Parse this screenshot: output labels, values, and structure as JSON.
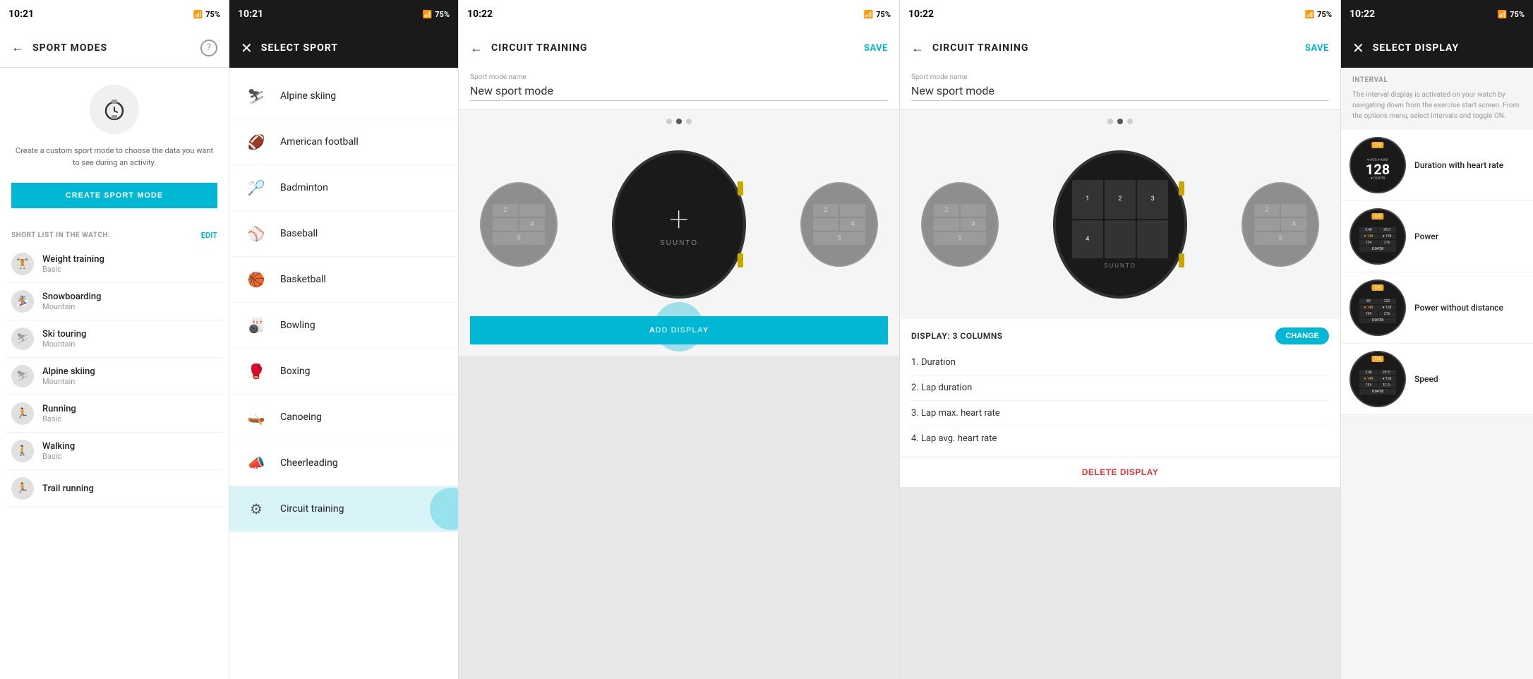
{
  "panel1": {
    "status_bar": {
      "time": "10:21",
      "battery": "75%"
    },
    "title": "SPORT MODES",
    "description": "Create a custom sport mode to choose the data you want to see during an activity.",
    "create_btn": "CREATE SPORT MODE",
    "short_list_title": "SHORT LIST IN THE WATCH:",
    "edit_label": "EDIT",
    "help": "?",
    "sport_items": [
      {
        "name": "Weight training",
        "sub": "Basic",
        "icon": "🏋"
      },
      {
        "name": "Snowboarding",
        "sub": "Mountain",
        "icon": "🏂"
      },
      {
        "name": "Ski touring",
        "sub": "Mountain",
        "icon": "⛷"
      },
      {
        "name": "Alpine skiing",
        "sub": "Mountain",
        "icon": "⛷"
      },
      {
        "name": "Running",
        "sub": "Basic",
        "icon": "🏃"
      },
      {
        "name": "Walking",
        "sub": "Basic",
        "icon": "🚶"
      },
      {
        "name": "Trail running",
        "sub": "",
        "icon": "🏃"
      }
    ]
  },
  "panel2": {
    "status_bar": {
      "time": "10:21",
      "battery": "75%"
    },
    "title": "SELECT SPORT",
    "sports": [
      {
        "name": "Alpine skiing",
        "icon": "⛷"
      },
      {
        "name": "American football",
        "icon": "🏈"
      },
      {
        "name": "Badminton",
        "icon": "🏸"
      },
      {
        "name": "Baseball",
        "icon": "⚾"
      },
      {
        "name": "Basketball",
        "icon": "🏀"
      },
      {
        "name": "Bowling",
        "icon": "🎳"
      },
      {
        "name": "Boxing",
        "icon": "🥊"
      },
      {
        "name": "Canoeing",
        "icon": "🛶"
      },
      {
        "name": "Cheerleading",
        "icon": "📣"
      },
      {
        "name": "Circuit training",
        "icon": "⚙"
      }
    ]
  },
  "panel3": {
    "status_bar": {
      "time": "10:22",
      "battery": "75%"
    },
    "title": "CIRCUIT TRAINING",
    "save_label": "SAVE",
    "sport_mode_name_label": "Sport mode name",
    "sport_mode_name_value": "New sport mode",
    "add_display_btn": "ADD DISPLAY",
    "dots": [
      false,
      true,
      false
    ]
  },
  "panel4": {
    "status_bar": {
      "time": "10:22",
      "battery": "75%"
    },
    "title": "CIRCUIT TRAINING",
    "save_label": "SAVE",
    "sport_mode_name_label": "Sport mode name",
    "sport_mode_name_value": "New sport mode",
    "display_label": "DISPLAY: 3 COLUMNS",
    "change_label": "CHANGE",
    "fields": [
      "1. Duration",
      "2. Lap duration",
      "3. Lap max. heart rate",
      "4. Lap avg. heart rate"
    ],
    "delete_btn": "DELETE DISPLAY",
    "dots": [
      false,
      true,
      false
    ]
  },
  "panel5": {
    "status_bar": {
      "time": "10:22",
      "battery": "75%"
    },
    "title": "SELECT DISPLAY",
    "interval_label": "INTERVAL",
    "interval_desc": "The interval display is activated on your watch by navigating down from the exercise start screen. From the options menu, select intervals and toggle ON.",
    "display_options": [
      {
        "name": "Duration with heart rate",
        "badge": "2/6"
      },
      {
        "name": "Power",
        "badge": "2/6"
      },
      {
        "name": "Power without distance",
        "badge": "2/6"
      },
      {
        "name": "Speed",
        "badge": "2/6"
      }
    ]
  }
}
